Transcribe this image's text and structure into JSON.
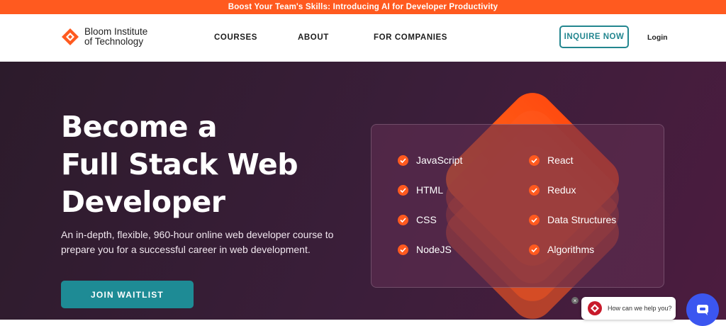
{
  "announcement": {
    "text": "Boost Your Team's Skills: Introducing AI for Developer Productivity"
  },
  "header": {
    "logo_line1": "Bloom Institute",
    "logo_line2": "of Technology",
    "nav": [
      "COURSES",
      "ABOUT",
      "FOR COMPANIES"
    ],
    "inquire_label": "INQUIRE NOW",
    "login_label": "Login"
  },
  "hero": {
    "title_line1": "Become a",
    "title_line2": "Full Stack Web",
    "title_line3": "Developer",
    "description": "An in-depth, flexible, 960-hour online web developer course to prepare you for a successful career in web development.",
    "cta_label": "JOIN WAITLIST"
  },
  "skills": {
    "left": [
      "JavaScript",
      "HTML",
      "CSS",
      "NodeJS"
    ],
    "right": [
      "React",
      "Redux",
      "Data Structures",
      "Algorithms"
    ]
  },
  "chat": {
    "prompt": "How can we help you?"
  },
  "colors": {
    "accent": "#ff5a1f",
    "teal": "#1e8b95",
    "chat_blue": "#3b56f0"
  }
}
